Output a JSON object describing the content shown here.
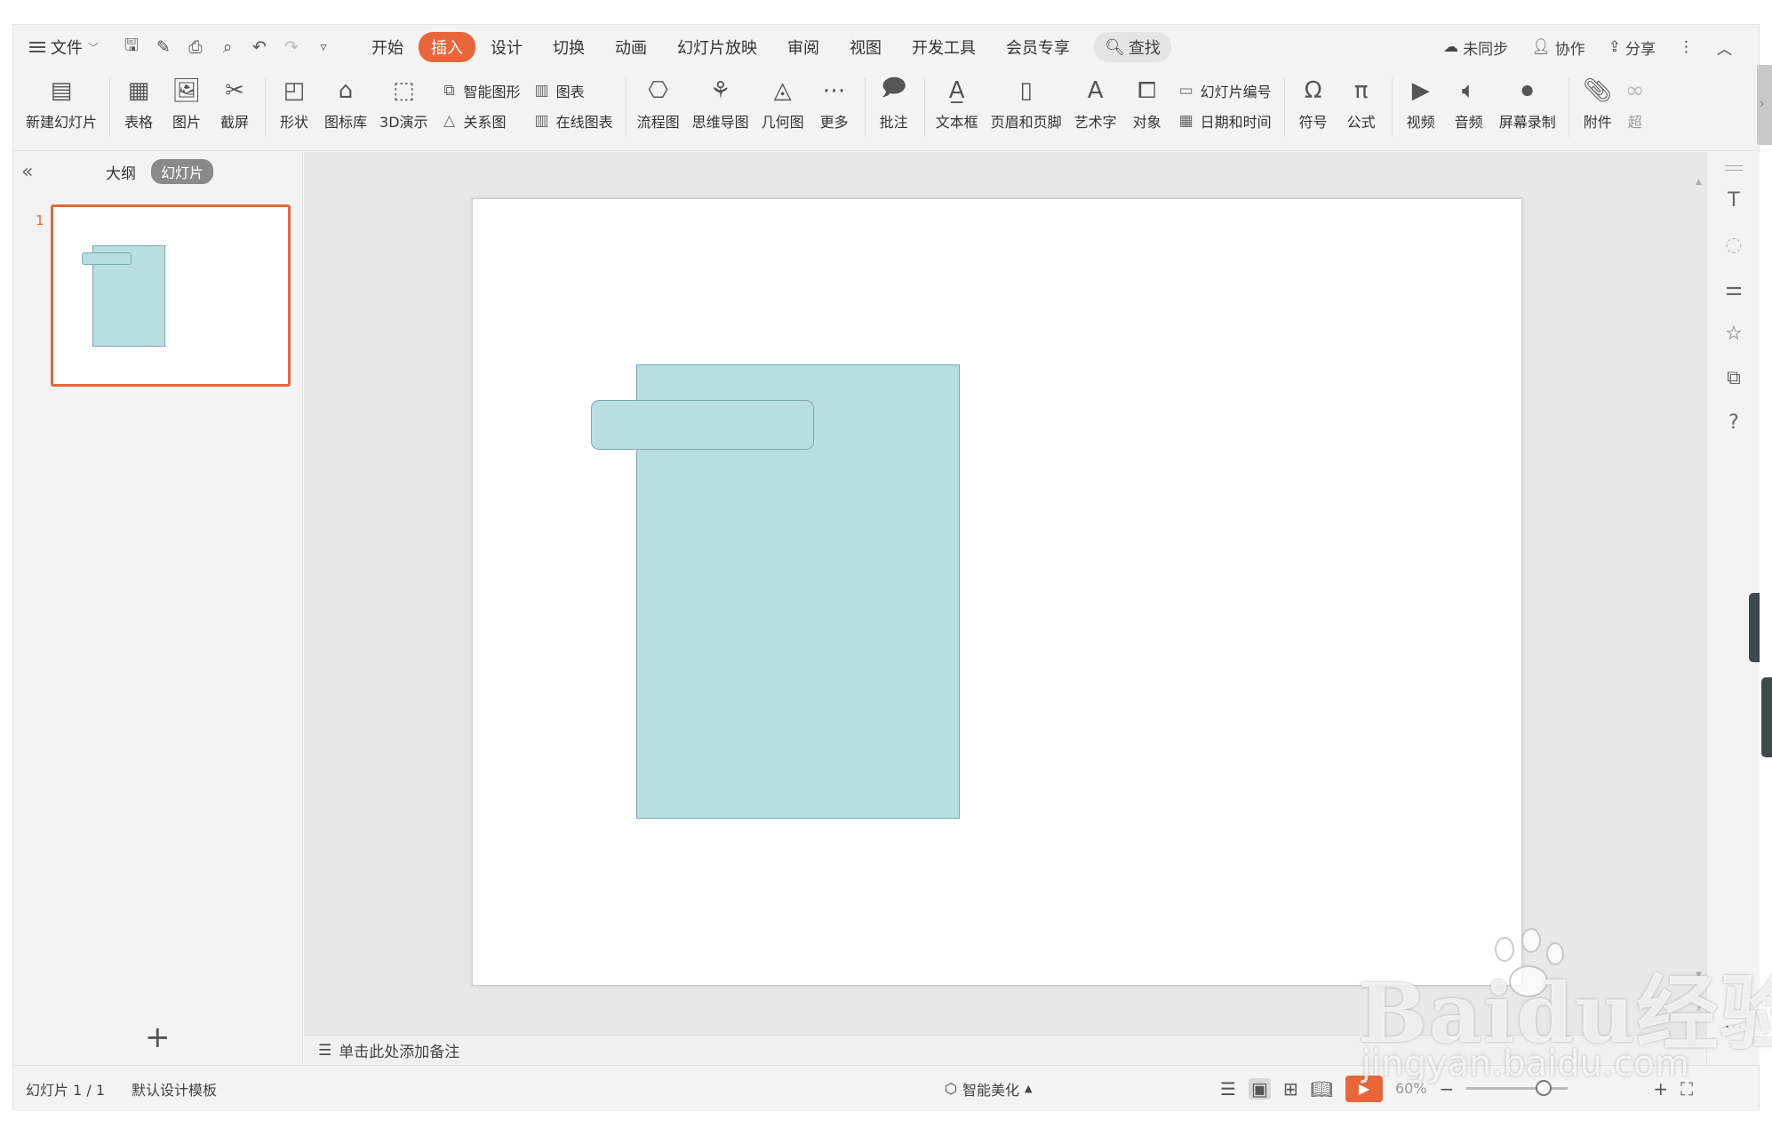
{
  "menubar": {
    "file_label": "文件",
    "tabs": [
      "开始",
      "插入",
      "设计",
      "切换",
      "动画",
      "幻灯片放映",
      "审阅",
      "视图",
      "开发工具",
      "会员专享"
    ],
    "active_tab": "插入",
    "search_label": "查找",
    "right": {
      "sync": "未同步",
      "collab": "协作",
      "share": "分享"
    }
  },
  "ribbon": {
    "new_slide": "新建幻灯片",
    "table": "表格",
    "picture": "图片",
    "screenshot": "截屏",
    "shape": "形状",
    "icon_lib": "图标库",
    "demo3d": "3D演示",
    "smart_shape": "智能图形",
    "chart": "图表",
    "relation": "关系图",
    "online_chart": "在线图表",
    "flowchart": "流程图",
    "mindmap": "思维导图",
    "geometry": "几何图",
    "more": "更多",
    "comment": "批注",
    "textbox": "文本框",
    "header_footer": "页眉和页脚",
    "wordart": "艺术字",
    "object": "对象",
    "slide_number": "幻灯片编号",
    "datetime": "日期和时间",
    "symbol": "符号",
    "formula": "公式",
    "video": "视频",
    "audio": "音频",
    "screen_record": "屏幕录制",
    "attachment": "附件",
    "hyperlink_cut": "超"
  },
  "panel": {
    "tab_outline": "大纲",
    "tab_slides": "幻灯片",
    "slide_index": "1"
  },
  "notes_placeholder": "单击此处添加备注",
  "status": {
    "slide_info": "幻灯片 1 / 1",
    "template": "默认设计模板",
    "beautify": "智能美化",
    "zoom": "60%",
    "zoom_level": 0.6
  },
  "colors": {
    "accent": "#e8663a",
    "shape_fill": "#b8dee2",
    "shape_stroke": "#7aaab0"
  },
  "watermark": {
    "logo": "Baidu经验",
    "url": "jingyan.baidu.com"
  }
}
